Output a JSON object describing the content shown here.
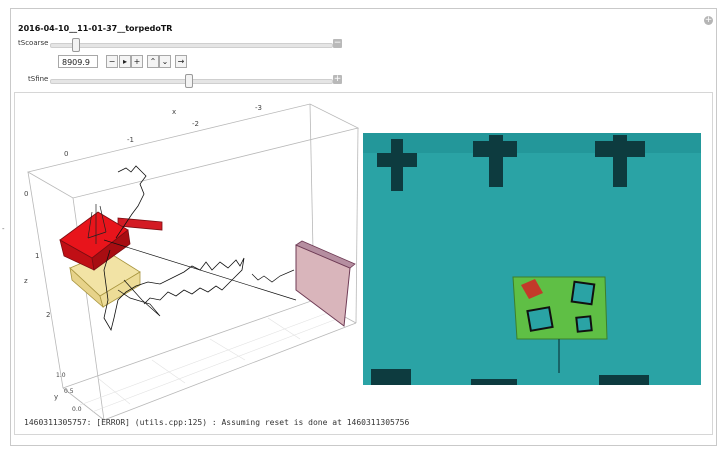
{
  "header": {
    "title": "2016-04-10__11-01-37__torpedoTR"
  },
  "controls": {
    "coarse_label": "tScoarse",
    "coarse_fraction": 0.09,
    "coarse_value": "8909.9",
    "fine_label": "tSfine",
    "fine_fraction": 0.49,
    "buttons": {
      "minus": "−",
      "play": "▸",
      "plus": "+",
      "faster": "⌃",
      "slower": "⌄",
      "direction": "→"
    },
    "collapse_coarse": "−",
    "expand_fine": "+",
    "corner_add": "+"
  },
  "plot3d": {
    "x_axis_label": "x",
    "x_ticks": [
      "0",
      "-1",
      "-2",
      "-3"
    ],
    "z_axis_label": "z",
    "z_ticks": [
      "0",
      "1",
      "2"
    ],
    "y_axis_label": "y",
    "y_ticks": [
      "1.0",
      "0.5",
      "0.0"
    ]
  },
  "side_marker": "-",
  "log": {
    "message": "1460311305757: [ERROR] (utils.cpp:125) : Assuming reset is done at 1460311305756"
  },
  "colors": {
    "water": "#2aa3a5",
    "board": "#5fbf45",
    "sub_red": "#e8141b",
    "pool_wall": "#d9b5bb"
  }
}
